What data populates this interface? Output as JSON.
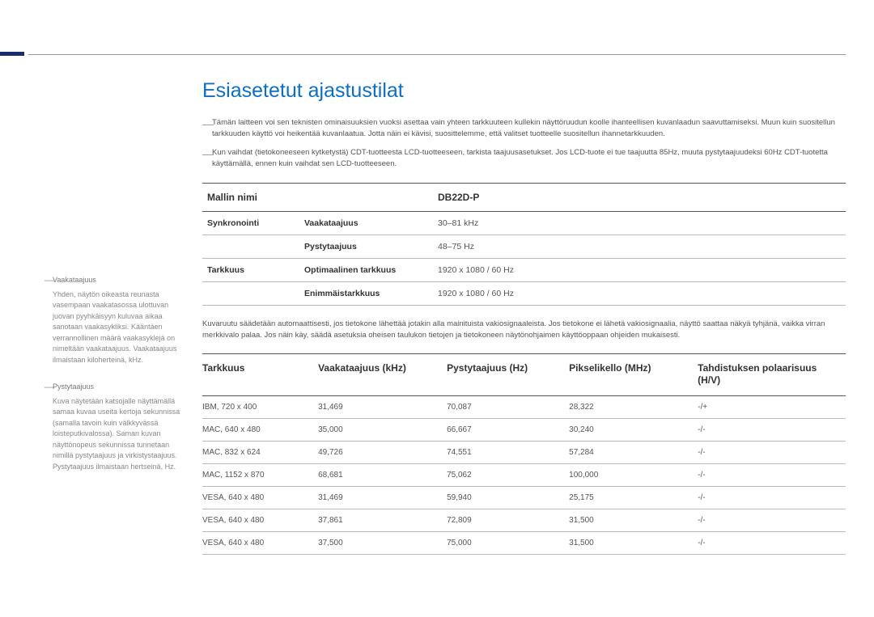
{
  "title": "Esiasetetut ajastustilat",
  "intro": [
    "Tämän laitteen voi sen teknisten ominaisuuksien vuoksi asettaa vain yhteen tarkkuuteen kullekin näyttöruudun koolle ihanteellisen kuvanlaadun saavuttamiseksi. Muun kuin suositellun tarkkuuden käyttö voi heikentää kuvanlaatua. Jotta näin ei kävisi, suosittelemme, että valitset tuotteelle suositellun ihannetarkkuuden.",
    "Kun vaihdat (tietokoneeseen kytketystä) CDT-tuotteesta LCD-tuotteeseen, tarkista taajuusasetukset. Jos LCD-tuote ei tue taajuutta 85Hz, muuta pystytaajuudeksi 60Hz CDT-tuotetta käyttämällä, ennen kuin vaihdat sen LCD-tuotteeseen."
  ],
  "specHeader": {
    "col1": "Mallin nimi",
    "col2": "DB22D-P"
  },
  "specRows": [
    {
      "label": "Synkronointi",
      "sublabel": "Vaakataajuus",
      "value": "30–81 kHz"
    },
    {
      "label": "",
      "sublabel": "Pystytaajuus",
      "value": "48–75 Hz"
    },
    {
      "label": "Tarkkuus",
      "sublabel": "Optimaalinen tarkkuus",
      "value": "1920 x 1080 / 60 Hz"
    },
    {
      "label": "",
      "sublabel": "Enimmäistarkkuus",
      "value": "1920 x 1080 / 60 Hz"
    }
  ],
  "paragraph": "Kuvaruutu säädetään automaattisesti, jos tietokone lähettää jotakin alla mainituista vakiosignaaleista. Jos tietokone ei lähetä vakiosignaalia, näyttö saattaa näkyä tyhjänä, vaikka virran merkkivalo palaa. Jos näin käy, säädä asetuksia oheisen taulukon tietojen ja tietokoneen näytönohjaimen käyttöoppaan ohjeiden mukaisesti.",
  "timingHeaders": [
    "Tarkkuus",
    "Vaakataajuus (kHz)",
    "Pystytaajuus (Hz)",
    "Pikselikello (MHz)",
    "Tahdistuksen polaarisuus (H/V)"
  ],
  "timingRows": [
    [
      "IBM, 720 x 400",
      "31,469",
      "70,087",
      "28,322",
      "-/+"
    ],
    [
      "MAC, 640 x 480",
      "35,000",
      "66,667",
      "30,240",
      "-/-"
    ],
    [
      "MAC, 832 x 624",
      "49,726",
      "74,551",
      "57,284",
      "-/-"
    ],
    [
      "MAC, 1152 x 870",
      "68,681",
      "75,062",
      "100,000",
      "-/-"
    ],
    [
      "VESA, 640 x 480",
      "31,469",
      "59,940",
      "25,175",
      "-/-"
    ],
    [
      "VESA, 640 x 480",
      "37,861",
      "72,809",
      "31,500",
      "-/-"
    ],
    [
      "VESA, 640 x 480",
      "37,500",
      "75,000",
      "31,500",
      "-/-"
    ]
  ],
  "sidebar": [
    {
      "title": "Vaakataajuus",
      "body": "Yhden, näytön oikeasta reunasta vasempaan vaakatasossa ulottuvan juovan pyyhkäisyyn kuluvaa aikaa sanotaan vaakasykliksi. Kääntäen verrannollinen määrä vaakasyklejä on nimeltään vaakataajuus. Vaakataajuus ilmaistaan kiloherteinä, kHz."
    },
    {
      "title": "Pystytaajuus",
      "body": "Kuva näytetään katsojalle näyttämällä samaa kuvaa useita kertoja sekunnissa (samalla tavoin kuin välkkyvässä loisteputkivalossa). Saman kuvan näyttönopeus sekunnissa tunnetaan nimillä pystytaajuus ja virkistystaajuus. Pystytaajuus ilmaistaan hertseinä, Hz."
    }
  ]
}
